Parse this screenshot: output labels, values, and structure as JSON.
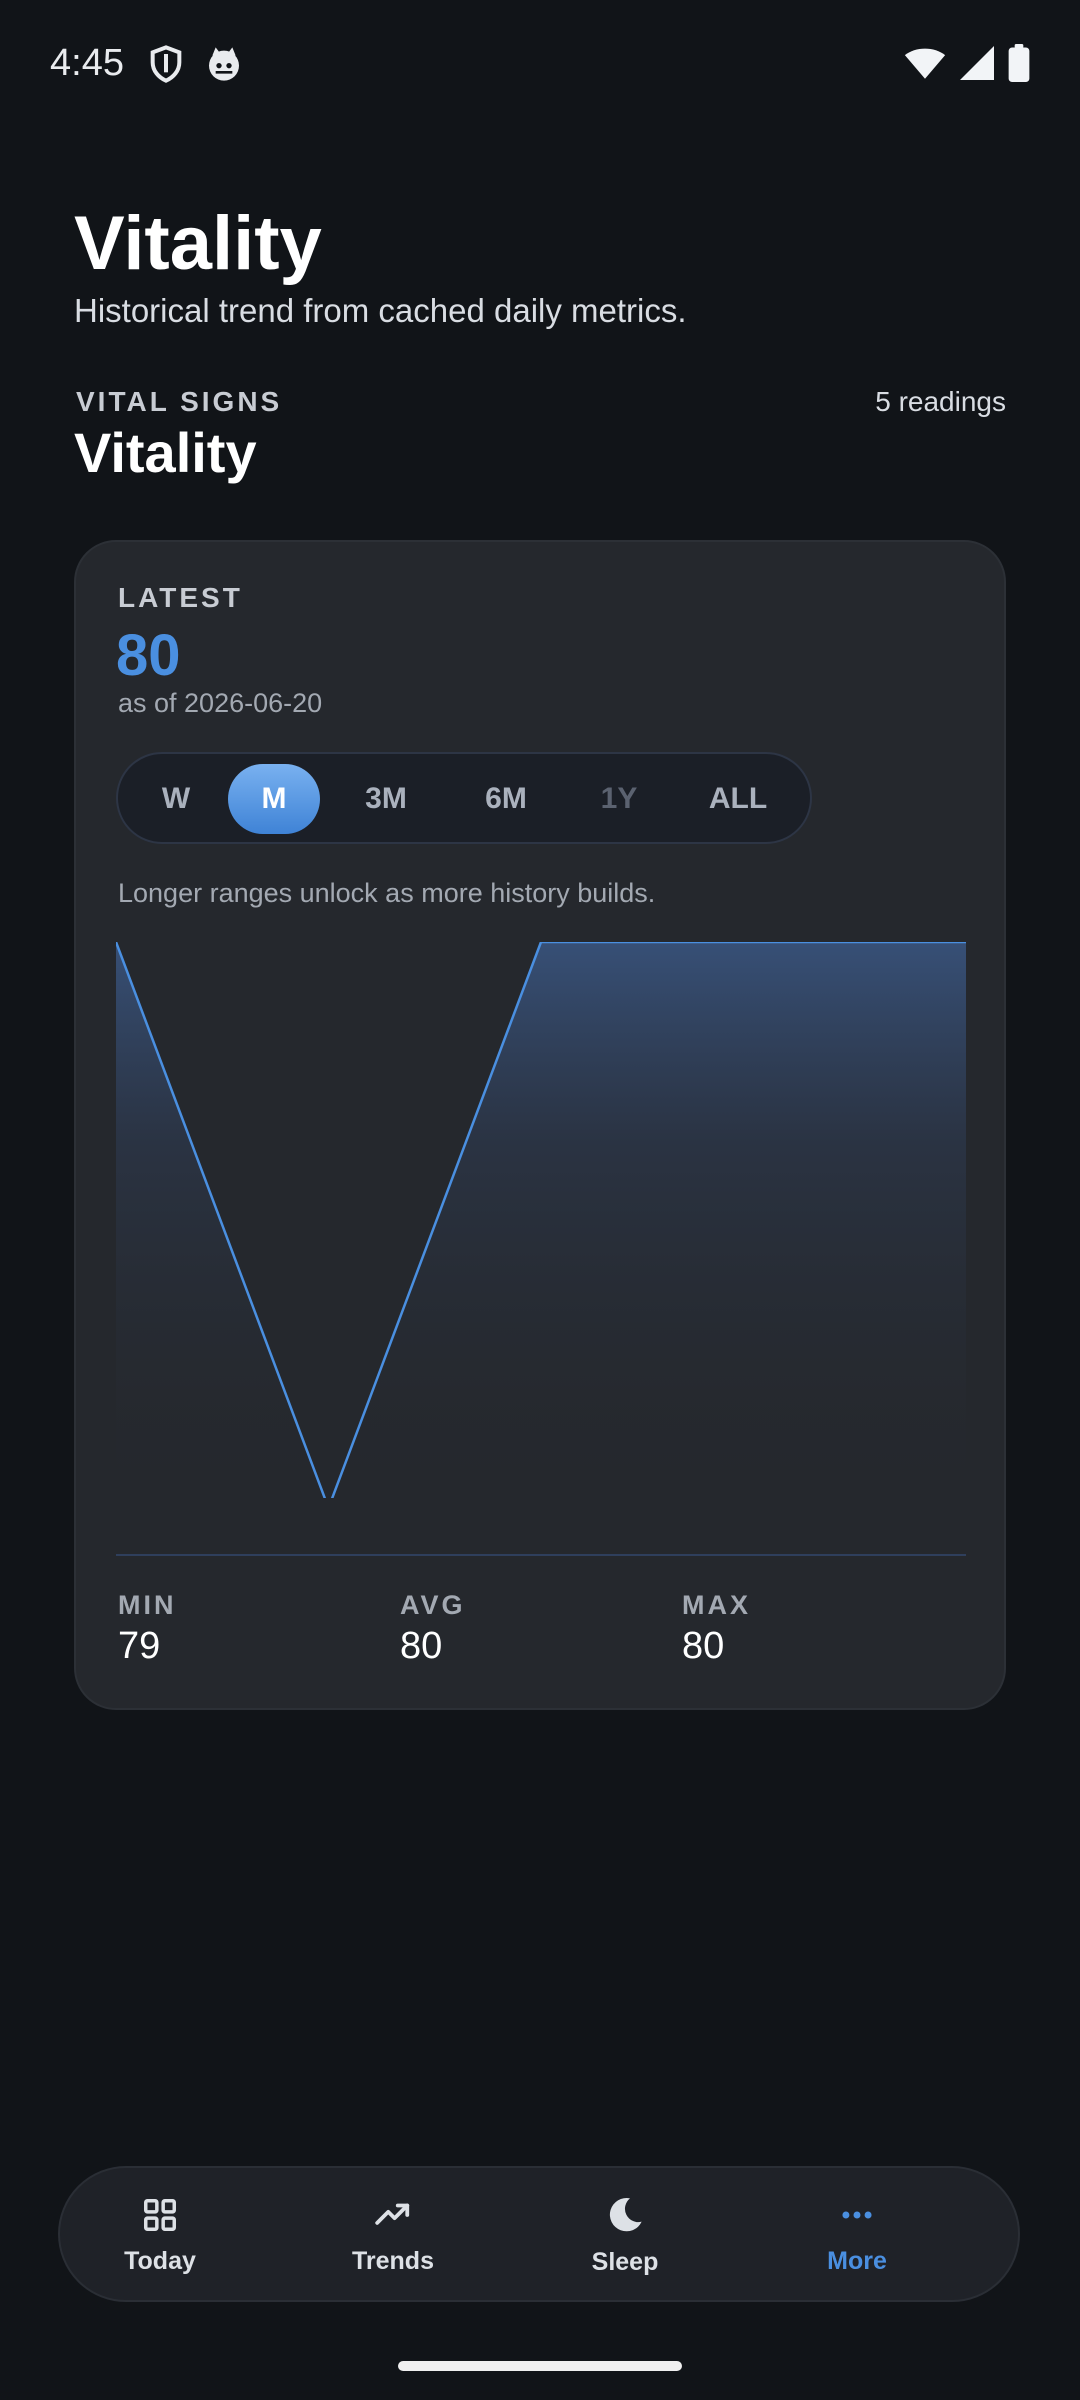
{
  "status_bar": {
    "time": "4:45",
    "icons": [
      "shield-icon",
      "cat-icon",
      "wifi-icon",
      "signal-icon",
      "battery-icon"
    ]
  },
  "header": {
    "title": "Vitality",
    "subtitle": "Historical trend from cached daily metrics."
  },
  "section": {
    "kicker": "VITAL SIGNS",
    "title": "Vitality",
    "readings": "5 readings"
  },
  "card": {
    "latest_label": "LATEST",
    "latest_value": "80",
    "latest_date": "as of 2026-06-20",
    "ranges": [
      {
        "label": "W",
        "state": "normal"
      },
      {
        "label": "M",
        "state": "active"
      },
      {
        "label": "3M",
        "state": "normal"
      },
      {
        "label": "6M",
        "state": "normal"
      },
      {
        "label": "1Y",
        "state": "disabled"
      },
      {
        "label": "ALL",
        "state": "normal"
      }
    ],
    "hint": "Longer ranges unlock as more history builds.",
    "stats": {
      "min_label": "MIN",
      "min_value": "79",
      "avg_label": "AVG",
      "avg_value": "80",
      "max_label": "MAX",
      "max_value": "80"
    }
  },
  "chart_data": {
    "type": "area",
    "series": [
      {
        "values": [
          80,
          79,
          80,
          80,
          80
        ]
      }
    ],
    "ylim": [
      79,
      80
    ],
    "line_color": "#4a8fe0",
    "grid": false
  },
  "nav": {
    "items": [
      {
        "label": "Today",
        "icon": "grid-icon",
        "active": false
      },
      {
        "label": "Trends",
        "icon": "trend-icon",
        "active": false
      },
      {
        "label": "Sleep",
        "icon": "moon-icon",
        "active": false
      },
      {
        "label": "More",
        "icon": "more-dots-icon",
        "active": true
      }
    ]
  },
  "colors": {
    "background": "#111418",
    "card": "#25282d",
    "accent": "#4a8fe0"
  }
}
